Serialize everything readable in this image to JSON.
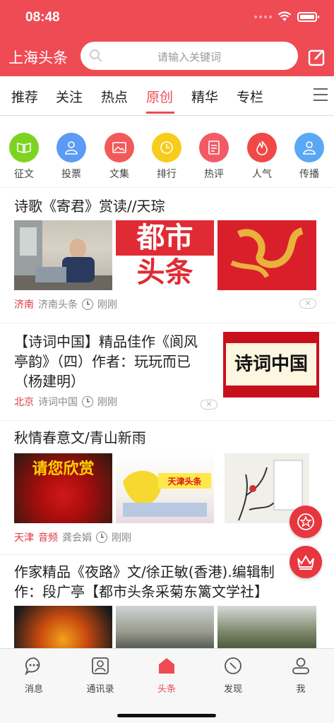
{
  "status": {
    "time": "08:48"
  },
  "header": {
    "title": "上海头条",
    "search_placeholder": "请输入关键词"
  },
  "tabs": [
    {
      "label": "推荐"
    },
    {
      "label": "关注"
    },
    {
      "label": "热点"
    },
    {
      "label": "原创",
      "active": true
    },
    {
      "label": "精华"
    },
    {
      "label": "专栏"
    }
  ],
  "categories": [
    {
      "label": "征文",
      "color": "#7ed321",
      "icon": "book-icon"
    },
    {
      "label": "投票",
      "color": "#5b9bf5",
      "icon": "person-icon"
    },
    {
      "label": "文集",
      "color": "#f25a5a",
      "icon": "image-icon"
    },
    {
      "label": "排行",
      "color": "#f8cc1b",
      "icon": "clock-icon"
    },
    {
      "label": "热评",
      "color": "#f25a66",
      "icon": "document-icon"
    },
    {
      "label": "人气",
      "color": "#f04848",
      "icon": "flame-icon"
    },
    {
      "label": "传播",
      "color": "#5aa8f5",
      "icon": "person-icon"
    }
  ],
  "articles": [
    {
      "title": "诗歌《寄君》赏读//天琮",
      "location": "济南",
      "source": "济南头条",
      "time": "刚刚"
    },
    {
      "title_lines": [
        "【诗词中国】精品佳作《阆风",
        "亭韵》（四）作者：玩玩而已",
        "（杨建明）"
      ],
      "location": "北京",
      "source": "诗词中国",
      "time": "刚刚",
      "thumb_text": "诗词中国"
    },
    {
      "title": "秋情春意文/青山新雨",
      "location": "天津",
      "tag": "音频",
      "source": "龚会娟",
      "time": "刚刚",
      "thumb1_text": "请您欣赏",
      "thumb2_text": "天津头条"
    },
    {
      "title_lines": [
        "作家精品《夜路》文/徐正敏(香港).编辑制",
        "作：段广亭【都市头条采菊东篱文学社】"
      ]
    }
  ],
  "thumb_texts": {
    "dushi": "都市",
    "toutiao": "头条"
  },
  "bottom_nav": [
    {
      "label": "消息",
      "icon": "chat-icon"
    },
    {
      "label": "通讯录",
      "icon": "contacts-icon"
    },
    {
      "label": "头条",
      "icon": "home-icon",
      "active": true
    },
    {
      "label": "发现",
      "icon": "compass-icon"
    },
    {
      "label": "我",
      "icon": "user-icon"
    }
  ],
  "colors": {
    "accent": "#ee4b55"
  }
}
